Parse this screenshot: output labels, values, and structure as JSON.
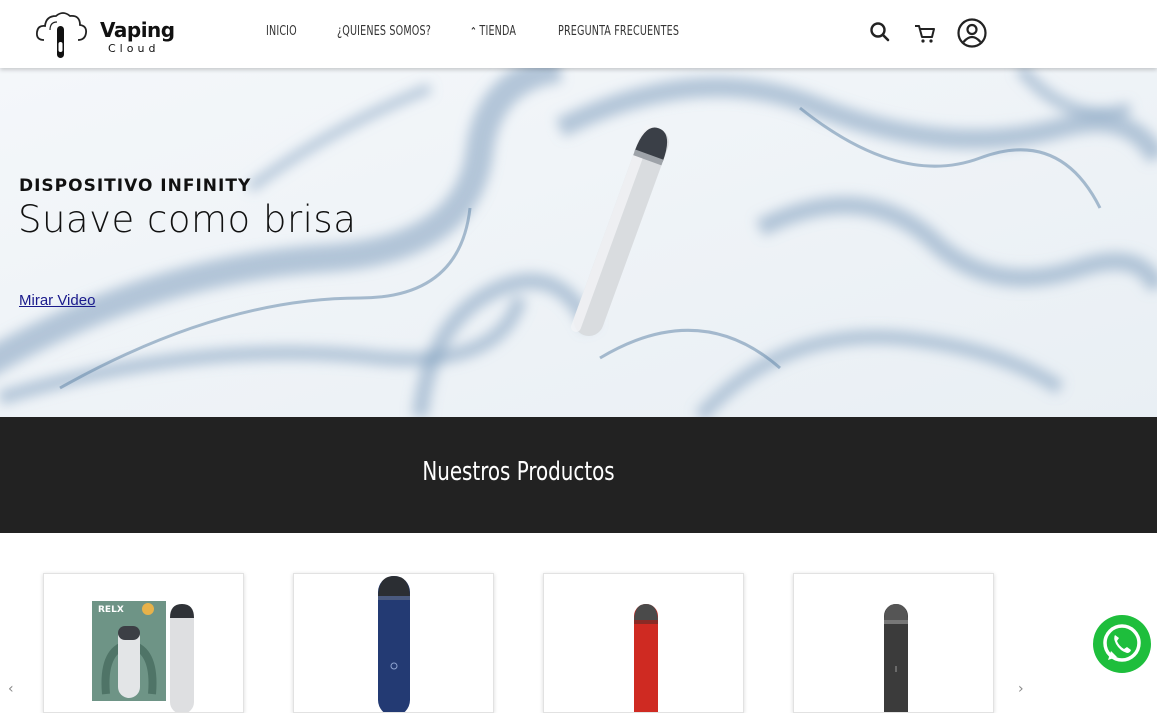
{
  "brand": {
    "name": "Vaping",
    "sub": "Cloud",
    "logo_icon": "cloud-vape-logo"
  },
  "nav": {
    "items": [
      {
        "label": "INICIO"
      },
      {
        "label": "¿QUIENES SOMOS?"
      },
      {
        "label": "TIENDA",
        "icon": "chevron-up-icon"
      },
      {
        "label": "PREGUNTA FRECUENTES"
      }
    ]
  },
  "header_icons": [
    "search-icon",
    "cart-icon",
    "user-icon"
  ],
  "hero": {
    "eyebrow": "DISPOSITIVO INFINITY",
    "title": "Suave como brisa",
    "link": "Mirar Video"
  },
  "section": {
    "title": "Nuestros Productos"
  },
  "products": [
    {
      "brand_text": "RELX",
      "device_color": "#d7d9dc",
      "box_color": "#6e9486"
    },
    {
      "device_color": "#233a73"
    },
    {
      "device_color": "#cf2a22"
    },
    {
      "device_color": "#3b3b3b"
    }
  ],
  "colors": {
    "band": "#222222",
    "whatsapp": "#1ebe3c"
  },
  "floating": {
    "icon": "whatsapp-icon"
  },
  "carousel": {
    "prev_icon": "chevron-left-icon",
    "next_icon": "chevron-right-icon"
  }
}
